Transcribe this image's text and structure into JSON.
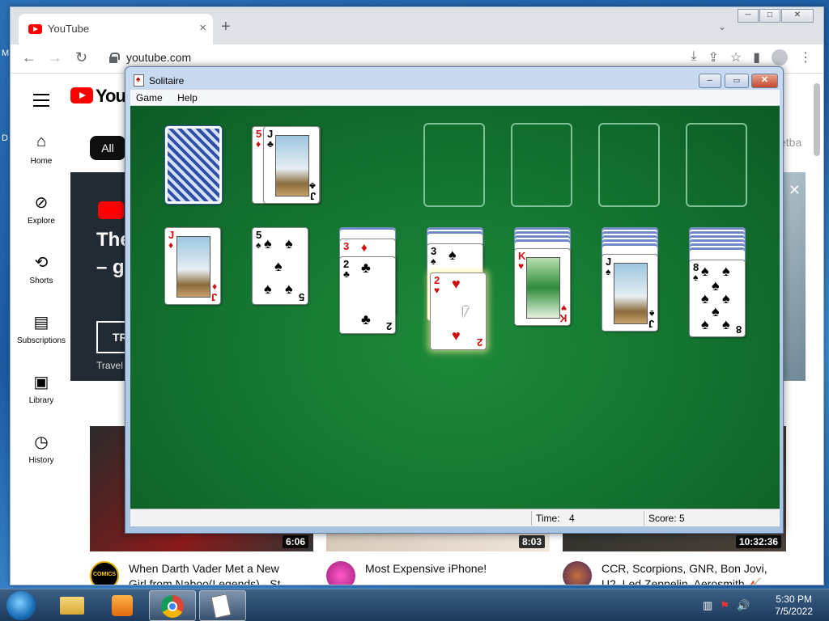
{
  "desktop": {
    "stub_left_top": "M",
    "stub_left_mid": "D"
  },
  "browser": {
    "tab_title": "YouTube",
    "url": "youtube.com",
    "new_tab_glyph": "+",
    "close_glyph": "×"
  },
  "youtube": {
    "logo_text": "YouTube",
    "chip_all": "All",
    "chip_right": "etba",
    "sidebar": [
      {
        "label": "Home",
        "icon": "home-icon"
      },
      {
        "label": "Explore",
        "icon": "explore-icon"
      },
      {
        "label": "Shorts",
        "icon": "shorts-icon"
      },
      {
        "label": "Subscriptions",
        "icon": "subscriptions-icon"
      },
      {
        "label": "Library",
        "icon": "library-icon"
      },
      {
        "label": "History",
        "icon": "history-icon"
      }
    ],
    "banner": {
      "line1": "The",
      "line2": "– g",
      "button": "TR",
      "subtext": "Travel"
    },
    "videos": [
      {
        "duration": "6:06",
        "title": "When Darth Vader Met a New Girl from Naboo(Legends) - St",
        "channel_badge": "COMICS"
      },
      {
        "duration": "8:03",
        "title": "Most Expensive iPhone!"
      },
      {
        "duration": "10:32:36",
        "title": "CCR, Scorpions, GNR, Bon Jovi, U2, Led Zeppelin, Aerosmith 🎸"
      }
    ]
  },
  "solitaire": {
    "title": "Solitaire",
    "menu": [
      "Game",
      "Help"
    ],
    "status": {
      "time_label": "Time:",
      "time_value": "4",
      "score_label": "Score: 5"
    },
    "cards": {
      "waste_back": {
        "rank": "5",
        "suit": "♦"
      },
      "waste_top": {
        "rank": "J",
        "suit": "♣"
      },
      "t1": {
        "rank": "J",
        "suit": "♦"
      },
      "t2": {
        "rank": "5",
        "suit": "♠"
      },
      "t3_under": {
        "rank": "3",
        "suit": "♦"
      },
      "t3_top": {
        "rank": "2",
        "suit": "♣"
      },
      "t4_under": {
        "rank": "3",
        "suit": "♠"
      },
      "t4_drag": {
        "rank": "2",
        "suit": "♥"
      },
      "t5": {
        "rank": "K",
        "suit": "♥"
      },
      "t6": {
        "rank": "J",
        "suit": "♠"
      },
      "t7": {
        "rank": "8",
        "suit": "♠"
      }
    }
  },
  "taskbar": {
    "time": "5:30 PM",
    "date": "7/5/2022"
  }
}
